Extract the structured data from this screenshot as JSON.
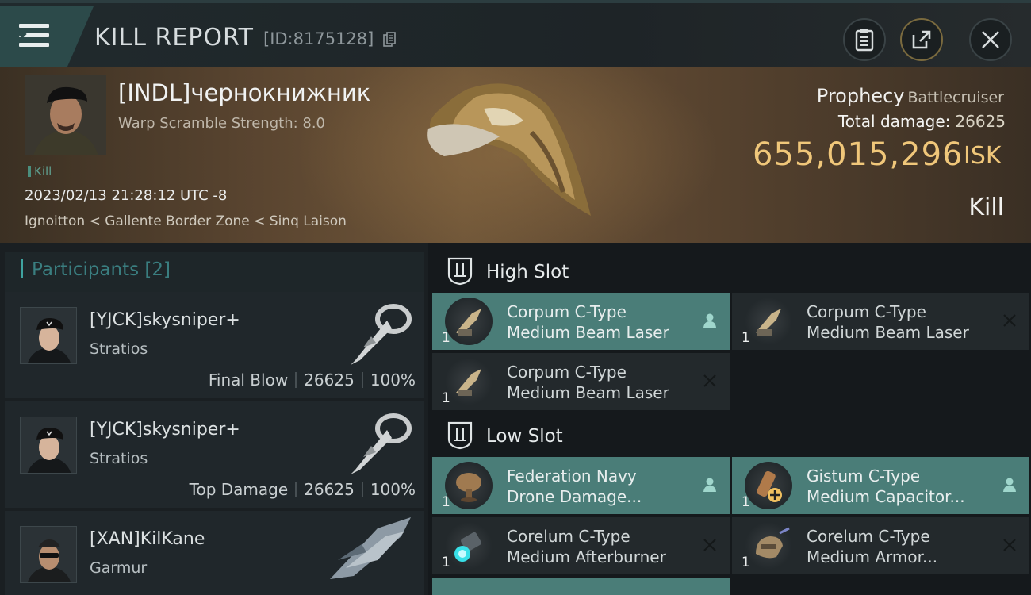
{
  "header": {
    "title": "KILL REPORT",
    "report_id": "[ID:8175128]",
    "menu_icon": "hamburger-icon",
    "buttons": [
      "clipboard-icon",
      "share-icon",
      "close-icon"
    ]
  },
  "victim": {
    "pilot_name": "[INDL]чернокнижник",
    "warp_scramble": "Warp Scramble Strength: 8.0",
    "tag": "Kill",
    "timestamp": "2023/02/13 21:28:12 UTC -8",
    "location": "Ignoitton < Gallente Border Zone < Sinq Laison",
    "ship_name": "Prophecy",
    "ship_class": "Battlecruiser",
    "total_damage_label": "Total damage:",
    "total_damage": "26625",
    "isk_value": "655,015,296",
    "isk_unit": "ISK",
    "result": "Kill"
  },
  "participants": {
    "title": "Participants [2]",
    "items": [
      {
        "name": "[YJCK]skysniper+",
        "ship": "Stratios",
        "role": "Final Blow",
        "damage": "26625",
        "percent": "100%"
      },
      {
        "name": "[YJCK]skysniper+",
        "ship": "Stratios",
        "role": "Top Damage",
        "damage": "26625",
        "percent": "100%"
      },
      {
        "name": "[XAN]KilKane",
        "ship": "Garmur"
      }
    ]
  },
  "slots": {
    "high": {
      "label": "High Slot",
      "modules": [
        {
          "line1": "Corpum C-Type",
          "line2": "Medium Beam Laser",
          "qty": "1",
          "status": "dropped"
        },
        {
          "line1": "Corpum C-Type",
          "line2": "Medium Beam Laser",
          "qty": "1",
          "status": "destroyed"
        },
        {
          "line1": "Corpum C-Type",
          "line2": "Medium Beam Laser",
          "qty": "1",
          "status": "destroyed"
        }
      ]
    },
    "low": {
      "label": "Low Slot",
      "modules": [
        {
          "line1": "Federation Navy",
          "line2": "Drone Damage...",
          "qty": "1",
          "status": "dropped"
        },
        {
          "line1": "Gistum C-Type",
          "line2": "Medium Capacitor...",
          "qty": "1",
          "status": "dropped"
        },
        {
          "line1": "Corelum C-Type",
          "line2": "Medium Afterburner",
          "qty": "1",
          "status": "destroyed"
        },
        {
          "line1": "Corelum C-Type",
          "line2": "Medium Armor...",
          "qty": "1",
          "status": "destroyed"
        }
      ]
    }
  },
  "colors": {
    "accent": "#3fa3a0",
    "isk": "#f0c77a",
    "dropped": "#4a7d78"
  }
}
